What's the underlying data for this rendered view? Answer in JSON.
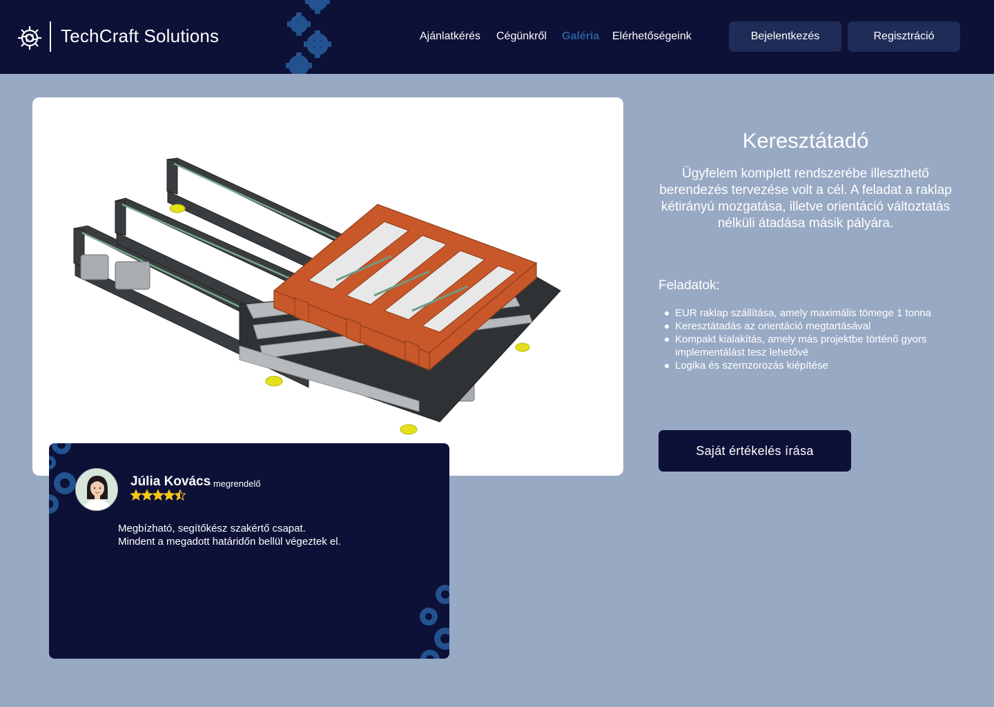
{
  "brand": {
    "name": "TechCraft Solutions",
    "logo_icon": "gear-circuit-icon"
  },
  "nav": {
    "items": [
      {
        "label": "Ajánlatkérés"
      },
      {
        "label": "Cégünkről"
      },
      {
        "label": "Galéria",
        "active": true
      },
      {
        "label": "Elérhetőségeink"
      }
    ],
    "login_label": "Bejelentkezés",
    "register_label": "Regisztráció"
  },
  "project": {
    "image_icon": "pallet-cross-transfer-conveyor-image",
    "title": "Keresztátadó",
    "description": "Ügyfelem komplett rendszerébe illeszthető berendezés tervezése volt a cél. A feladat a raklap kétirányú mozgatása, illetve orientáció változtatás nélküli átadása másik pályára.",
    "tasks_heading": "Feladatok:",
    "tasks": [
      "EUR raklap szállítása, amely maximális tömege 1 tonna",
      "Keresztátadás az orientáció megtartásával",
      "Kompakt kialakítás, amely más projektbe történő gyors implementálást tesz lehetővé",
      "Logika és szernzorozás kiépítése"
    ],
    "review_button_label": "Saját értékelés írása"
  },
  "review": {
    "name": "Júlia Kovács",
    "role": "- megrendelő",
    "rating": 4.5,
    "rating_max": 5,
    "text_line1": "Megbízható, segítőkész szakértő csapat.",
    "text_line2": "Mindent a megadott határidőn bellül végeztek el."
  },
  "colors": {
    "header_bg": "#0d1137",
    "page_bg": "#98a9c4",
    "button_bg": "#1f2c57",
    "active_nav": "#2a5f9c",
    "star": "#f5c518",
    "pallet": "#c8582a"
  }
}
